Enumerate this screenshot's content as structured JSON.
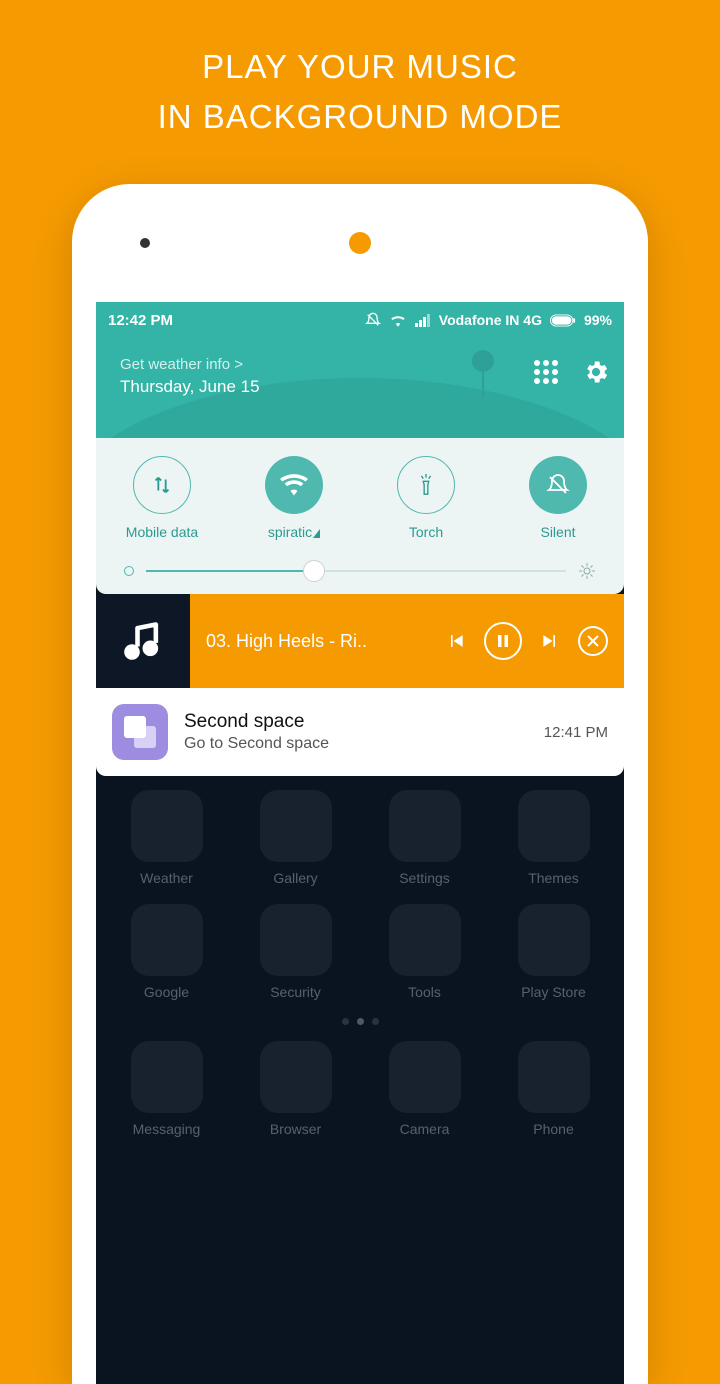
{
  "promo": {
    "line1": "PLAY YOUR MUSIC",
    "line2": "IN BACKGROUND MODE"
  },
  "status": {
    "time": "12:42 PM",
    "carrier": "Vodafone IN 4G",
    "battery": "99%"
  },
  "header": {
    "weather_link": "Get weather info >",
    "date": "Thursday, June 15"
  },
  "qs": {
    "items": [
      {
        "label": "Mobile data",
        "on": false,
        "icon": "updown"
      },
      {
        "label": "spiratic",
        "on": true,
        "icon": "wifi",
        "tri": true
      },
      {
        "label": "Torch",
        "on": false,
        "icon": "torch"
      },
      {
        "label": "Silent",
        "on": true,
        "icon": "bell-off"
      }
    ]
  },
  "music": {
    "title": "03. High Heels - Ri.."
  },
  "notif": {
    "title": "Second space",
    "subtitle": "Go to Second space",
    "time": "12:41 PM"
  },
  "home_rows": [
    [
      "Weather",
      "Gallery",
      "Settings",
      "Themes"
    ],
    [
      "Google",
      "Security",
      "Tools",
      "Play Store"
    ]
  ],
  "dock": [
    "Messaging",
    "Browser",
    "Camera",
    "Phone"
  ]
}
